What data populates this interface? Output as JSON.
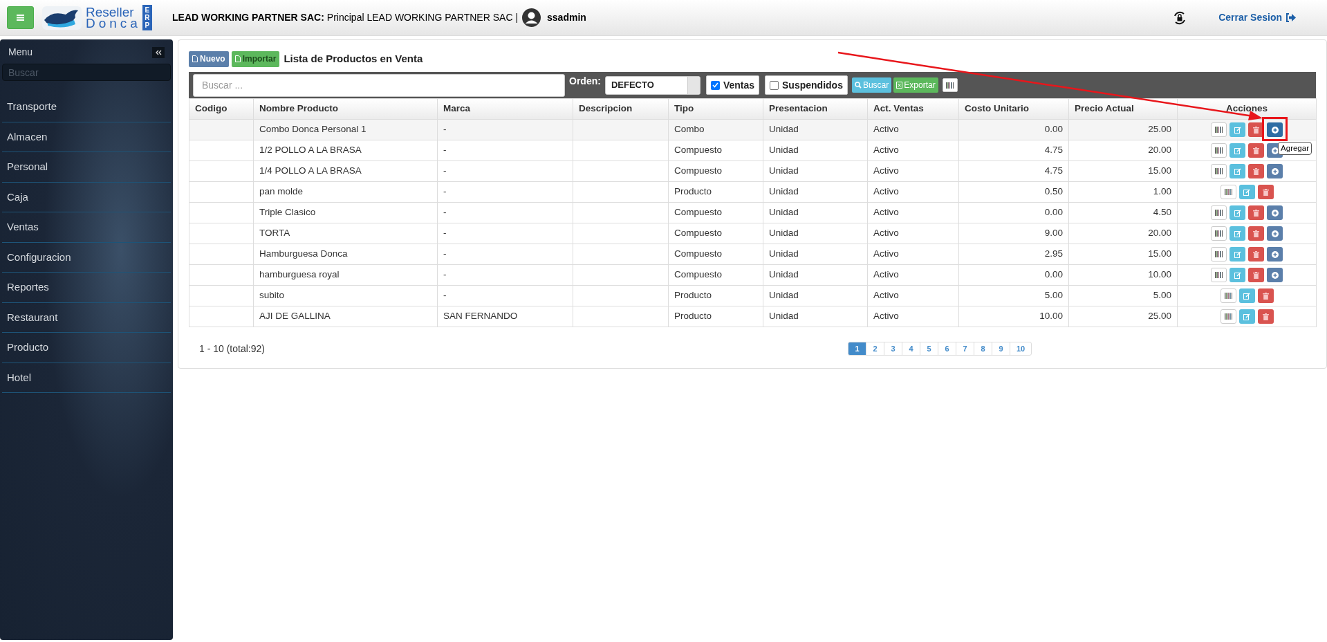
{
  "header": {
    "brand_top": "Reseller",
    "brand_bottom": "Donca",
    "brand_badge": "ERP",
    "company": "LEAD WORKING PARTNER SAC:",
    "branch": "Principal LEAD WORKING PARTNER SAC |",
    "user": "ssadmin",
    "logout": "Cerrar Sesion"
  },
  "sidebar": {
    "title": "Menu",
    "search_placeholder": "Buscar",
    "items": [
      "Transporte",
      "Almacen",
      "Personal",
      "Caja",
      "Ventas",
      "Configuracion",
      "Reportes",
      "Restaurant",
      "Producto",
      "Hotel"
    ]
  },
  "toolbar": {
    "new_button": "Nuevo",
    "import_button": "Importar",
    "title": "Lista de Productos en Venta",
    "search_placeholder": "Buscar ...",
    "order_label": "Orden:",
    "order_value": "DEFECTO",
    "filters": [
      {
        "label": "Ventas",
        "checked": true
      },
      {
        "label": "Suspendidos",
        "checked": false
      }
    ],
    "search_button": "Buscar",
    "export_button": "Exportar"
  },
  "table": {
    "columns": [
      "Codigo",
      "Nombre Producto",
      "Marca",
      "Descripcion",
      "Tipo",
      "Presentacion",
      "Act. Ventas",
      "Costo Unitario",
      "Precio Actual",
      "Acciones"
    ],
    "rows": [
      {
        "selected": true,
        "has_add": true,
        "cells": [
          "",
          "Combo Donca Personal 1",
          "-",
          "",
          "Combo",
          "Unidad",
          "Activo",
          "0.00",
          "25.00"
        ]
      },
      {
        "selected": false,
        "has_add": true,
        "cells": [
          "",
          "1/2 POLLO A LA BRASA",
          "-",
          "",
          "Compuesto",
          "Unidad",
          "Activo",
          "4.75",
          "20.00"
        ]
      },
      {
        "selected": false,
        "has_add": true,
        "cells": [
          "",
          "1/4 POLLO A LA BRASA",
          "-",
          "",
          "Compuesto",
          "Unidad",
          "Activo",
          "4.75",
          "15.00"
        ]
      },
      {
        "selected": false,
        "has_add": false,
        "cells": [
          "",
          "pan molde",
          "-",
          "",
          "Producto",
          "Unidad",
          "Activo",
          "0.50",
          "1.00"
        ]
      },
      {
        "selected": false,
        "has_add": true,
        "cells": [
          "",
          "Triple Clasico",
          "-",
          "",
          "Compuesto",
          "Unidad",
          "Activo",
          "0.00",
          "4.50"
        ]
      },
      {
        "selected": false,
        "has_add": true,
        "cells": [
          "",
          "TORTA",
          "-",
          "",
          "Compuesto",
          "Unidad",
          "Activo",
          "9.00",
          "20.00"
        ]
      },
      {
        "selected": false,
        "has_add": true,
        "cells": [
          "",
          "Hamburguesa Donca",
          "-",
          "",
          "Compuesto",
          "Unidad",
          "Activo",
          "2.95",
          "15.00"
        ]
      },
      {
        "selected": false,
        "has_add": true,
        "cells": [
          "",
          "hamburguesa royal",
          "-",
          "",
          "Compuesto",
          "Unidad",
          "Activo",
          "0.00",
          "10.00"
        ]
      },
      {
        "selected": false,
        "has_add": false,
        "cells": [
          "",
          "subito",
          "-",
          "",
          "Producto",
          "Unidad",
          "Activo",
          "5.00",
          "5.00"
        ]
      },
      {
        "selected": false,
        "has_add": false,
        "cells": [
          "",
          "AJI DE GALLINA",
          "SAN FERNANDO",
          "",
          "Producto",
          "Unidad",
          "Activo",
          "10.00",
          "25.00"
        ]
      }
    ],
    "tooltip": "Agregar"
  },
  "footer": {
    "summary": "1 - 10 (total:92)",
    "pages": [
      {
        "label": "1",
        "selected": true
      },
      {
        "label": "2",
        "selected": false
      },
      {
        "label": "3",
        "selected": false
      },
      {
        "label": "4",
        "selected": false
      },
      {
        "label": "5",
        "selected": false
      },
      {
        "label": "6",
        "selected": false
      },
      {
        "label": "7",
        "selected": false
      },
      {
        "label": "8",
        "selected": false
      },
      {
        "label": "9",
        "selected": false
      },
      {
        "label": "10",
        "selected": false
      }
    ]
  }
}
